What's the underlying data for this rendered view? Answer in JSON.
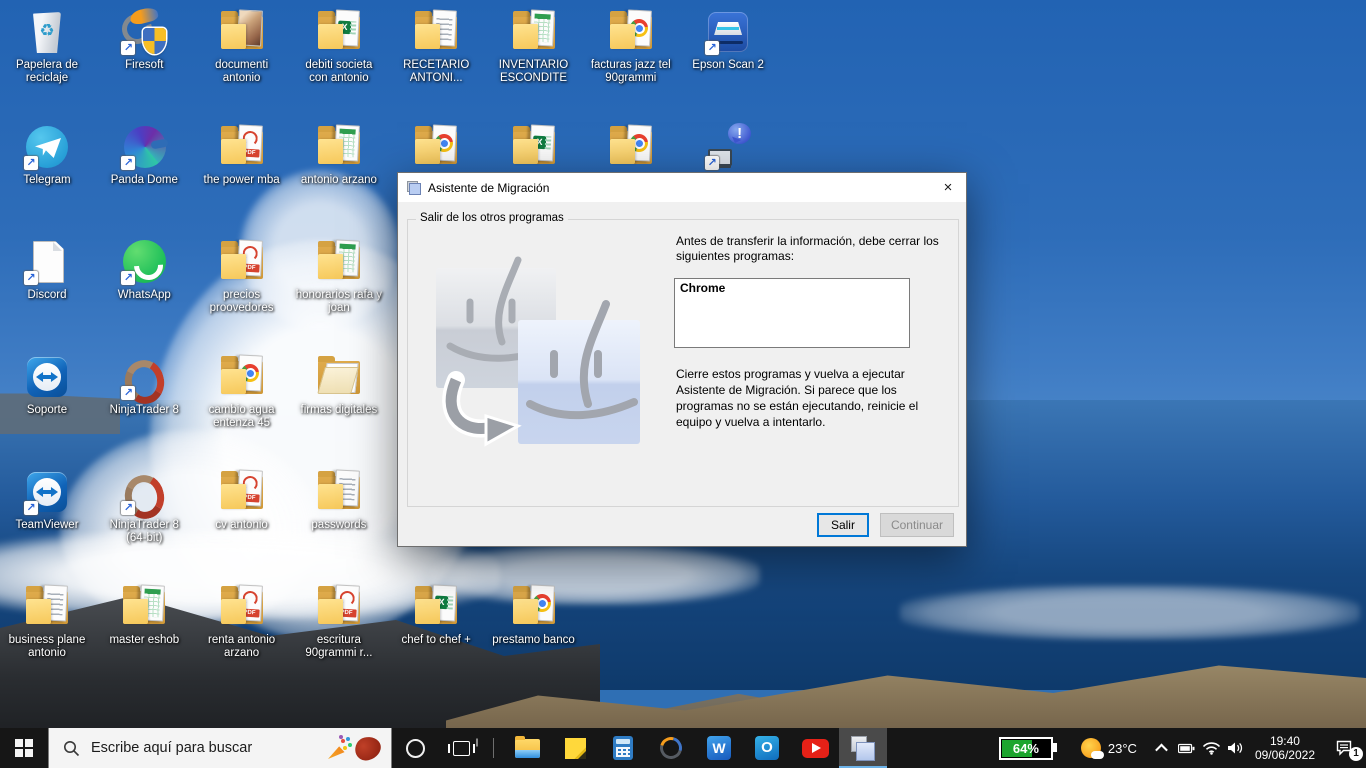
{
  "desktop": {
    "icons": [
      {
        "name": "recycle-bin",
        "label": "Papelera de reciclaje",
        "kind": "recycle",
        "col": 0,
        "row": 0,
        "shortcut": false
      },
      {
        "name": "firesoft",
        "label": "Firesoft",
        "kind": "firesoft",
        "col": 1,
        "row": 0,
        "shortcut": true
      },
      {
        "name": "documenti-antonio",
        "label": "documenti antonio",
        "kind": "folder",
        "motif": "photo",
        "col": 2,
        "row": 0
      },
      {
        "name": "debiti-societa-con-antonio",
        "label": "debiti societa con antonio",
        "kind": "folder",
        "motif": "excel",
        "col": 3,
        "row": 0
      },
      {
        "name": "recetario-antonio",
        "label": "RECETARIO ANTONI...",
        "kind": "folder",
        "motif": "lines",
        "col": 4,
        "row": 0
      },
      {
        "name": "inventario-escondite",
        "label": "INVENTARIO ESCONDITE",
        "kind": "folder",
        "motif": "grid",
        "col": 5,
        "row": 0
      },
      {
        "name": "facturas-jazz-tel-90grammi",
        "label": "facturas jazz tel 90grammi",
        "kind": "folder",
        "motif": "chrome",
        "col": 6,
        "row": 0
      },
      {
        "name": "epson-scan-2",
        "label": "Epson Scan 2",
        "kind": "epson",
        "col": 7,
        "row": 0,
        "shortcut": true
      },
      {
        "name": "telegram",
        "label": "Telegram",
        "kind": "telegram",
        "col": 0,
        "row": 1,
        "shortcut": true
      },
      {
        "name": "panda-dome",
        "label": "Panda Dome",
        "kind": "panda",
        "col": 1,
        "row": 1,
        "shortcut": true
      },
      {
        "name": "the-power-mba",
        "label": "the power mba",
        "kind": "folder",
        "motif": "pdf",
        "col": 2,
        "row": 1
      },
      {
        "name": "antonio-arzano",
        "label": "antonio arzano",
        "kind": "folder",
        "motif": "grid",
        "col": 3,
        "row": 1
      },
      {
        "name": "folder-chrome-hidden-1",
        "label": "",
        "kind": "folder",
        "motif": "chrome",
        "col": 4,
        "row": 1
      },
      {
        "name": "folder-excel-hidden",
        "label": "",
        "kind": "folder",
        "motif": "excel",
        "col": 5,
        "row": 1
      },
      {
        "name": "folder-chrome-hidden-2",
        "label": "",
        "kind": "folder",
        "motif": "chrome",
        "col": 6,
        "row": 1
      },
      {
        "name": "migration-alert",
        "label": "",
        "kind": "alertpc",
        "col": 7,
        "row": 1,
        "shortcut": true
      },
      {
        "name": "discord",
        "label": "Discord",
        "kind": "file",
        "col": 0,
        "row": 2,
        "shortcut": true
      },
      {
        "name": "whatsapp",
        "label": "WhatsApp",
        "kind": "whatsapp",
        "col": 1,
        "row": 2,
        "shortcut": true
      },
      {
        "name": "precios-proovedores",
        "label": "precios proovedores",
        "kind": "folder",
        "motif": "pdf",
        "col": 2,
        "row": 2
      },
      {
        "name": "honorarios-rafa-y-joan",
        "label": "honorarios rafa y joan",
        "kind": "folder",
        "motif": "grid",
        "col": 3,
        "row": 2
      },
      {
        "name": "soporte",
        "label": "Soporte",
        "kind": "teamviewer",
        "col": 0,
        "row": 3,
        "shortcut": false
      },
      {
        "name": "ninjatrader-8",
        "label": "NinjaTrader 8",
        "kind": "ninjatrader",
        "col": 1,
        "row": 3,
        "shortcut": true
      },
      {
        "name": "cambio-agua-entenza-45",
        "label": "cambio agua entenza 45",
        "kind": "folder",
        "motif": "chrome",
        "col": 2,
        "row": 3
      },
      {
        "name": "firmas-digitales",
        "label": "firmas digitales",
        "kind": "folderopen",
        "col": 3,
        "row": 3
      },
      {
        "name": "teamviewer",
        "label": "TeamViewer",
        "kind": "teamviewer",
        "col": 0,
        "row": 4,
        "shortcut": true
      },
      {
        "name": "ninjatrader-8-64-bit",
        "label": "NinjaTrader 8 (64-bit)",
        "kind": "ninjatrader",
        "col": 1,
        "row": 4,
        "shortcut": true
      },
      {
        "name": "cv-antonio",
        "label": "cv antonio",
        "kind": "folder",
        "motif": "pdf",
        "col": 2,
        "row": 4
      },
      {
        "name": "passwords",
        "label": "passwords",
        "kind": "folder",
        "motif": "lines",
        "col": 3,
        "row": 4
      },
      {
        "name": "business-plane-antonio",
        "label": "business plane antonio",
        "kind": "folder",
        "motif": "lines",
        "col": 0,
        "row": 5
      },
      {
        "name": "master-eshob",
        "label": "master eshob",
        "kind": "folder",
        "motif": "grid",
        "col": 1,
        "row": 5
      },
      {
        "name": "renta-antonio-arzano",
        "label": "renta antonio arzano",
        "kind": "folder",
        "motif": "pdf",
        "col": 2,
        "row": 5
      },
      {
        "name": "escritura-90grammi",
        "label": "escritura 90grammi r...",
        "kind": "folder",
        "motif": "pdf",
        "col": 3,
        "row": 5
      },
      {
        "name": "chef-to-chef",
        "label": "chef to chef +",
        "kind": "folder",
        "motif": "excel",
        "col": 4,
        "row": 5
      },
      {
        "name": "prestamo-banco",
        "label": "prestamo banco",
        "kind": "folder",
        "motif": "chrome",
        "col": 5,
        "row": 5
      }
    ]
  },
  "dialog": {
    "title": "Asistente de Migración",
    "close_glyph": "×",
    "group_label": "Salir de los otros programas",
    "instruction": "Antes de transferir la información, debe cerrar los siguientes programas:",
    "programs": [
      "Chrome"
    ],
    "note": "Cierre estos programas y vuelva a ejecutar Asistente de Migración. Si parece que los programas no se están ejecutando, reinicie el equipo y vuelva a intentarlo.",
    "exit_label": "Salir",
    "continue_label": "Continuar"
  },
  "taskbar": {
    "search_placeholder": "Escribe aquí para buscar",
    "pinned": [
      {
        "name": "file-explorer"
      },
      {
        "name": "sticky-notes"
      },
      {
        "name": "calculator"
      },
      {
        "name": "firesoft"
      },
      {
        "name": "word"
      },
      {
        "name": "outlook"
      },
      {
        "name": "youtube"
      },
      {
        "name": "migration-assistant",
        "active": true
      }
    ],
    "tray": {
      "battery_percent": "64%",
      "temperature": "23°C",
      "time": "19:40",
      "date": "09/06/2022",
      "notifications": "1"
    }
  },
  "colors": {
    "accent": "#0078d7",
    "taskbar": "#161616",
    "battery_fill": "#1ca52e",
    "sky": "#2e6db9"
  }
}
